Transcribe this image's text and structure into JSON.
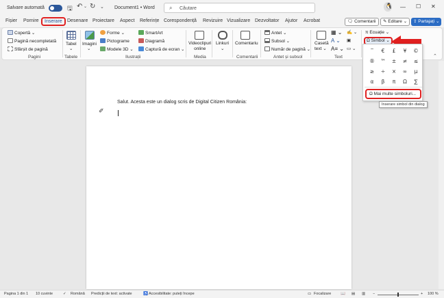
{
  "titlebar": {
    "autosave": "Salvare automată",
    "doc_title": "Document1 • Word",
    "search_placeholder": "Căutare",
    "win_min": "—",
    "win_max": "☐",
    "win_close": "✕"
  },
  "tabs": {
    "fisier": "Fișier",
    "pornire": "Pornire",
    "inserare": "Inserare",
    "desenare": "Desenare",
    "proiectare": "Proiectare",
    "aspect": "Aspect",
    "referinte": "Referințe",
    "corespondenta": "Corespondență",
    "revizuire": "Revizuire",
    "vizualizare": "Vizualizare",
    "dezvoltator": "Dezvoltator",
    "ajutor": "Ajutor",
    "acrobat": "Acrobat",
    "comentarii": "Comentarii",
    "editare": "Editare",
    "partajati": "Partajați"
  },
  "ribbon": {
    "pagini": {
      "coperta": "Copertă",
      "pagina_necompletata": "Pagină necompletată",
      "sfarsit_pagina": "Sfârșit de pagină",
      "label": "Pagini"
    },
    "tabele": {
      "tabel": "Tabel",
      "label": "Tabele"
    },
    "ilustratii": {
      "imagini": "Imagini",
      "forme": "Forme",
      "pictograme": "Pictograme",
      "modele_3d": "Modele 3D",
      "smartart": "SmartArt",
      "diagrama": "Diagramă",
      "captura": "Captură de ecran",
      "label": "Ilustrații"
    },
    "media": {
      "video_line1": "Videoclipuri",
      "video_line2": "online",
      "label": "Media"
    },
    "linkuri": {
      "linkuri": "Linkuri"
    },
    "comentarii": {
      "comentariu": "Comentariu",
      "label": "Comentarii"
    },
    "antet": {
      "antet": "Antet",
      "subsol": "Subsol",
      "numar_pagina": "Număr de pagină",
      "label": "Antet și subsol"
    },
    "text": {
      "caseta_line1": "Casetă",
      "caseta_line2": "text",
      "label": "Text"
    },
    "simboluri": {
      "ecuatie": "Ecuație",
      "simbol": "Simbol"
    }
  },
  "document": {
    "text": "Salut. Acesta este un dialog scris de Digital Citizen România:"
  },
  "symbol_menu": {
    "symbols": [
      "‾",
      "€",
      "£",
      "¥",
      "©",
      "®",
      "™",
      "±",
      "≠",
      "≤",
      "≥",
      "÷",
      "×",
      "∞",
      "µ",
      "α",
      "β",
      "π",
      "Ω",
      "∑"
    ],
    "more_symbols": "Mai multe simboluri...",
    "tooltip": "Inserare simbol din dialog"
  },
  "statusbar": {
    "pagina": "Pagina 1 din 1",
    "cuvinte": "10 cuvinte",
    "limba": "Română",
    "predictii": "Predicții de text: activate",
    "accesibilitate": "Accesibilitate: puteți începe",
    "focalizare": "Focalizare",
    "zoom": "100 %"
  },
  "colors": {
    "accent_blue": "#2b579a",
    "highlight_red": "#e02020"
  }
}
